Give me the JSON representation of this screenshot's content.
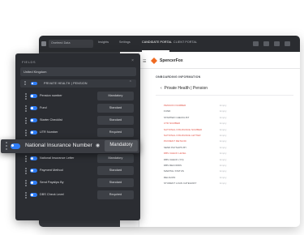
{
  "app": {
    "workspace_label": "Onefeed Data",
    "nav_tabs": [
      "Insights",
      "Settings",
      "CANDIDATE PORTAL",
      "CLIENT PORTAL"
    ],
    "logo_text": "SpencerFox",
    "section_title": "ONBOARDING INFORMATION",
    "section_name": "Private Health | Pension",
    "rows": [
      {
        "label": "PENSION NUMBER",
        "value": "Empty",
        "required": true
      },
      {
        "label": "FUND",
        "value": "Empty",
        "required": false
      },
      {
        "label": "STARTER CHECKLIST",
        "value": "Empty",
        "required": false
      },
      {
        "label": "UTR NUMBER",
        "value": "Empty",
        "required": true
      },
      {
        "label": "NATIONAL INSURANCE NUMBER",
        "value": "Empty",
        "required": true
      },
      {
        "label": "NATIONAL INSURANCE LETTER",
        "value": "Empty",
        "required": true
      },
      {
        "label": "PAYMENT METHOD",
        "value": "Empty",
        "required": true
      },
      {
        "label": "SEND PAYSLIPS BY",
        "value": "Empty",
        "required": false
      },
      {
        "label": "DBS CHECK LEVEL",
        "value": "Empty",
        "required": true
      },
      {
        "label": "DBS CHECK (YN)",
        "value": "Empty",
        "required": false
      },
      {
        "label": "DBS RECORDS",
        "value": "Empty",
        "required": false
      },
      {
        "label": "MARITAL STATUS",
        "value": "Empty",
        "required": false
      },
      {
        "label": "RELIGION",
        "value": "Empty",
        "required": false
      },
      {
        "label": "STUDENT LOAN CATEGORY",
        "value": "Empty",
        "required": false
      }
    ]
  },
  "panel": {
    "title": "FIELDS",
    "close_glyph": "×",
    "country": "United Kingdom",
    "group_label": "PRIVATE HEALTH | PENSION",
    "fields": [
      {
        "label": "Pension number",
        "requirement": "Mandatory"
      },
      {
        "label": "Fund",
        "requirement": "Standard"
      },
      {
        "label": "Starter Checklist",
        "requirement": "Standard"
      },
      {
        "label": "UTR Number",
        "requirement": "Required"
      },
      {
        "label": "National Insurance Letter",
        "requirement": "Mandatory"
      },
      {
        "label": "Payment Method",
        "requirement": "Standard"
      },
      {
        "label": "Send Payslips By",
        "requirement": "Standard"
      },
      {
        "label": "DBS Check Level",
        "requirement": "Required"
      }
    ],
    "highlight": {
      "label": "National Insurance Number",
      "requirement": "Mandatory"
    }
  },
  "colors": {
    "accent_toggle": "#2f7df6",
    "required_red": "#e2574c",
    "brand_orange": "#ef6a22",
    "panel_bg": "#2b2d32"
  }
}
